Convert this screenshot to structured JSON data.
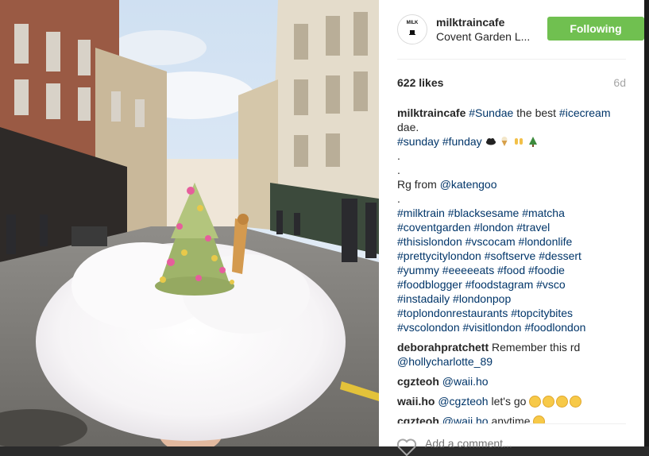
{
  "post": {
    "username": "milktraincafe",
    "location": "Covent Garden L...",
    "follow_label": "Following",
    "avatar_text": "MILK",
    "likes": "622 likes",
    "age": "6d"
  },
  "caption": {
    "line1": [
      "milktraincafe",
      " ",
      "#Sundae",
      " the best ",
      "#icecream"
    ],
    "line2": "dae.",
    "line3": [
      "#sunday",
      " ",
      "#funday"
    ],
    "dot1": ".",
    "dot2": ".",
    "credit": [
      "Rg from ",
      "@katengoo"
    ],
    "dot3": ".",
    "tag_lines": [
      [
        "#milktrain",
        "#blacksesame",
        "#matcha"
      ],
      [
        "#coventgarden",
        "#london",
        "#travel"
      ],
      [
        "#thisislondon",
        "#vscocam",
        "#londonlife"
      ],
      [
        "#prettycitylondon",
        "#softserve",
        "#dessert"
      ],
      [
        "#yummy",
        "#eeeeeats",
        "#food",
        "#foodie"
      ],
      [
        "#foodblogger",
        "#foodstagram",
        "#vsco"
      ],
      [
        "#instadaily",
        "#londonpop"
      ],
      [
        "#toplondonrestaurants",
        "#topcitybites"
      ],
      [
        "#vscolondon",
        "#visitlondon",
        "#foodlondon"
      ]
    ]
  },
  "comments": [
    {
      "user": "deborahpratchett",
      "text": " Remember this rd",
      "mention2": "@hollycharlotte_89"
    },
    {
      "user": "cgzteoh",
      "mention": "@waii.ho",
      "text": ""
    },
    {
      "user": "waii.ho",
      "mention": "@cgzteoh",
      "text": " let's go"
    },
    {
      "user": "cgzteoh",
      "mention": "@waii.ho",
      "text": " anytime"
    }
  ],
  "add_comment_placeholder": "Add a comment...",
  "colors": {
    "follow_bg": "#70c050",
    "link": "#003569",
    "panel_bg": "#ffffff"
  },
  "icons": [
    "heart-icon",
    "cloud-icon",
    "ice-cream-icon",
    "raised-hands-icon",
    "tree-icon",
    "smile-icon"
  ]
}
